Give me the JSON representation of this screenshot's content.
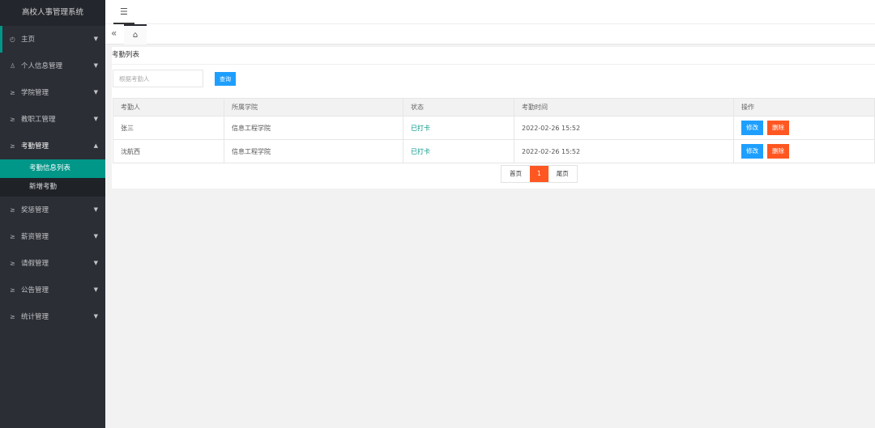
{
  "app": {
    "title": "高校人事管理系统"
  },
  "sidebar": {
    "items": [
      {
        "label": "主页",
        "icon": "dashboard-icon"
      },
      {
        "label": "个人信息管理",
        "icon": "user-icon"
      },
      {
        "label": "学院管理",
        "icon": "list-icon"
      },
      {
        "label": "教职工管理",
        "icon": "list-icon"
      },
      {
        "label": "考勤管理",
        "icon": "list-icon"
      },
      {
        "label": "奖惩管理",
        "icon": "list-icon"
      },
      {
        "label": "薪资管理",
        "icon": "list-icon"
      },
      {
        "label": "请假管理",
        "icon": "list-icon"
      },
      {
        "label": "公告管理",
        "icon": "list-icon"
      },
      {
        "label": "统计管理",
        "icon": "list-icon"
      }
    ],
    "sub_items": [
      {
        "label": "考勤信息列表"
      },
      {
        "label": "新增考勤"
      }
    ]
  },
  "page": {
    "title": "考勤列表"
  },
  "search": {
    "placeholder": "根据考勤人",
    "button_label": "查询"
  },
  "table": {
    "headers": [
      "考勤人",
      "所属学院",
      "状态",
      "考勤时间",
      "操作"
    ],
    "rows": [
      {
        "name": "张三",
        "college": "信息工程学院",
        "status": "已打卡",
        "time": "2022-02-26 15:52"
      },
      {
        "name": "沈航西",
        "college": "信息工程学院",
        "status": "已打卡",
        "time": "2022-02-26 15:52"
      }
    ],
    "edit_label": "修改",
    "delete_label": "删除"
  },
  "pager": {
    "first": "首页",
    "current": "1",
    "last": "尾页"
  },
  "colors": {
    "accent": "#009688",
    "primary": "#1e9fff",
    "danger": "#ff5722",
    "sidebar": "#2b2e35"
  }
}
